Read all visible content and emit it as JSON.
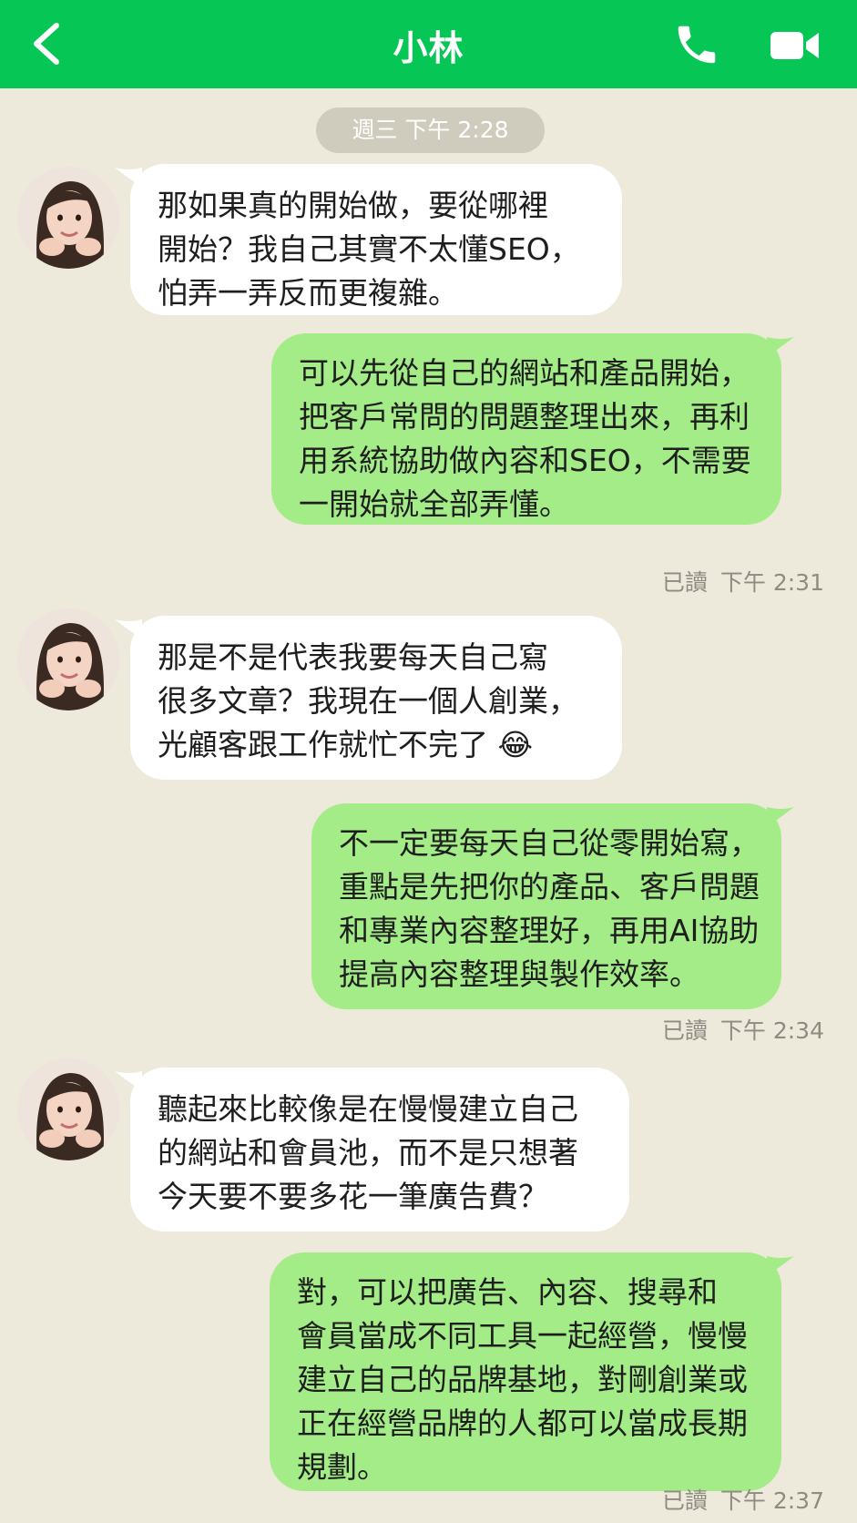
{
  "header": {
    "title": "小林",
    "bg_color": "#06c755",
    "back_icon": "chevron-left-icon",
    "call_icon": "phone-icon",
    "video_icon": "video-camera-icon"
  },
  "date_label": "週三 下午 2:28",
  "colors": {
    "background": "#eeeadb",
    "incoming_bubble": "#ffffff",
    "outgoing_bubble": "#a3ec87"
  },
  "messages": [
    {
      "direction": "incoming",
      "lines": [
        "那如果真的開始做，要從哪裡",
        "開始？我自己其實不太懂SEO，",
        "怕弄一弄反而更複雜。"
      ]
    },
    {
      "direction": "outgoing",
      "lines": [
        "可以先從自己的網站和產品開始，",
        "把客戶常問的問題整理出來，再利",
        "用系統協助做內容和SEO，不需要",
        "一開始就全部弄懂。"
      ],
      "read": "已讀",
      "time": "下午 2:31"
    },
    {
      "direction": "incoming",
      "lines": [
        "那是不是代表我要每天自己寫",
        "很多文章？我現在一個人創業，",
        "光顧客跟工作就忙不完了"
      ],
      "emoji": "😂"
    },
    {
      "direction": "outgoing",
      "lines": [
        "不一定要每天自己從零開始寫，",
        "重點是先把你的產品、客戶問題",
        "和專業內容整理好，再用AI協助",
        "提高內容整理與製作效率。"
      ],
      "read": "已讀",
      "time": "下午 2:34"
    },
    {
      "direction": "incoming",
      "lines": [
        "聽起來比較像是在慢慢建立自己",
        "的網站和會員池，而不是只想著",
        "今天要不要多花一筆廣告費？"
      ]
    },
    {
      "direction": "outgoing",
      "lines": [
        "對，可以把廣告、內容、搜尋和",
        "會員當成不同工具一起經營，慢慢",
        "建立自己的品牌基地，對剛創業或",
        "正在經營品牌的人都可以當成長期",
        "規劃。"
      ],
      "read": "已讀",
      "time": "下午 2:37"
    }
  ]
}
